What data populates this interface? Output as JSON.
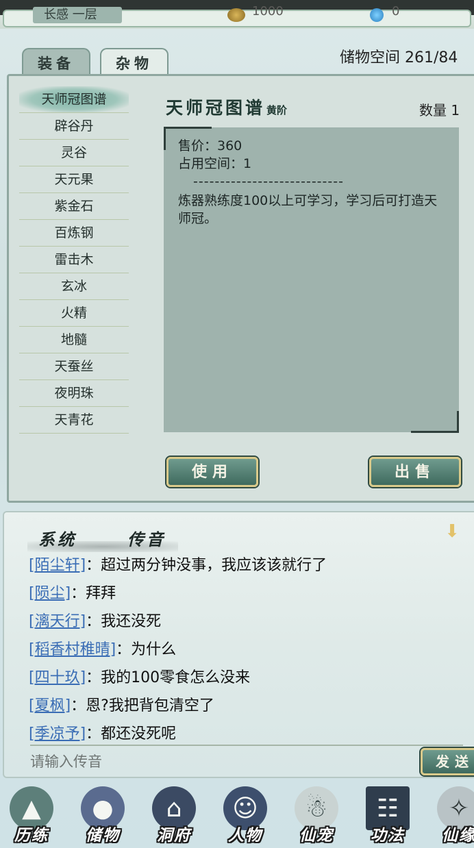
{
  "topbar": {
    "rank": "长感 一层",
    "coins": "1000",
    "gems": "0"
  },
  "tabs": [
    {
      "label": "装备",
      "active": false
    },
    {
      "label": "杂物",
      "active": true
    }
  ],
  "storage": "储物空间 261/84",
  "items": [
    "天师冠图谱",
    "辟谷丹",
    "灵谷",
    "天元果",
    "紫金石",
    "百炼钢",
    "雷击木",
    "玄冰",
    "火精",
    "地髓",
    "天蚕丝",
    "夜明珠",
    "天青花"
  ],
  "detail": {
    "title": "天师冠图谱",
    "grade": "黄阶",
    "quantity": "数量 1",
    "price": "售价：360",
    "space": "占用空间：1",
    "separator": "----------------------------",
    "description": "炼器熟练度100以上可学习，学习后可打造天师冠。"
  },
  "buttons": {
    "use": "使用",
    "sell": "出售",
    "send": "发送"
  },
  "chat": {
    "tabs": {
      "system": "系统",
      "voice": "传音"
    },
    "messages": [
      {
        "name": "[陌尘轩]",
        "text": "：超过两分钟没事，我应该该就行了"
      },
      {
        "name": "[陨尘]",
        "text": "：拜拜"
      },
      {
        "name": "[漓天行]",
        "text": "：我还没死"
      },
      {
        "name": "[稻香村稚晴]",
        "text": "：为什么"
      },
      {
        "name": "[四十玖]",
        "text": "：我的100零食怎么没来"
      },
      {
        "name": "[夏枫]",
        "text": "：恩?我把背包清空了"
      },
      {
        "name": "[季凉予]",
        "text": "：都还没死呢"
      }
    ],
    "input_placeholder": "请输入传音"
  },
  "nav": [
    {
      "label": "历练",
      "icon": "mountain-icon",
      "color": "#5d7f7a"
    },
    {
      "label": "储物",
      "icon": "gourd-bag-icon",
      "color": "#5a6b8f"
    },
    {
      "label": "洞府",
      "icon": "pavilion-icon",
      "color": "#3b4a63"
    },
    {
      "label": "人物",
      "icon": "character-icon",
      "color": "#3d4f6d"
    },
    {
      "label": "仙宠",
      "icon": "spirit-pet-icon",
      "color": "#c9d3d2"
    },
    {
      "label": "功法",
      "icon": "scroll-book-icon",
      "color": "#2f3d4d"
    },
    {
      "label": "仙缘",
      "icon": "crane-icon",
      "color": "#b9c3c6"
    }
  ]
}
